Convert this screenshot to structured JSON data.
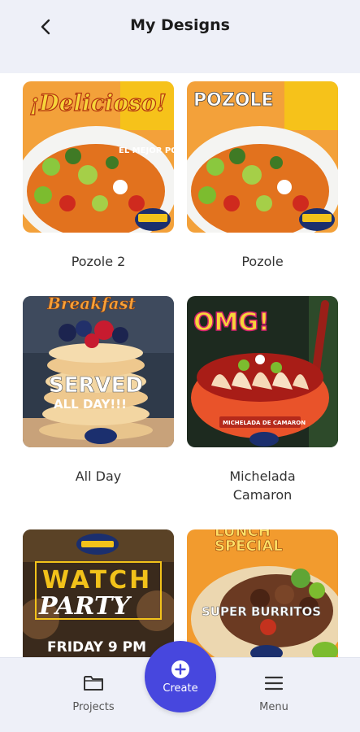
{
  "header": {
    "title": "My Designs",
    "back_icon": "chevron-left-icon"
  },
  "designs": [
    {
      "name": "Pozole 2",
      "headline": "¡Delicioso!",
      "subline": "EL MEJOR POZOLE"
    },
    {
      "name": "Pozole",
      "headline": "POZOLE"
    },
    {
      "name": "All Day",
      "headline": "Breakfast",
      "subline": "SERVED",
      "subline2": "ALL DAY!!!"
    },
    {
      "name": "Michelada\nCamaron",
      "headline": "OMG!",
      "subline": "MICHELADA DE CAMARON"
    },
    {
      "name": "",
      "headline": "WATCH",
      "subline": "PARTY",
      "subline2": "FRIDAY 9 PM"
    },
    {
      "name": "",
      "headline": "LUNCH",
      "subline": "SPECIAL",
      "subline2": "SUPER BURRITOS"
    }
  ],
  "bottom_nav": {
    "projects_label": "Projects",
    "create_label": "Create",
    "menu_label": "Menu"
  },
  "colors": {
    "accent": "#4747de",
    "header_bg": "#eef0f8"
  }
}
